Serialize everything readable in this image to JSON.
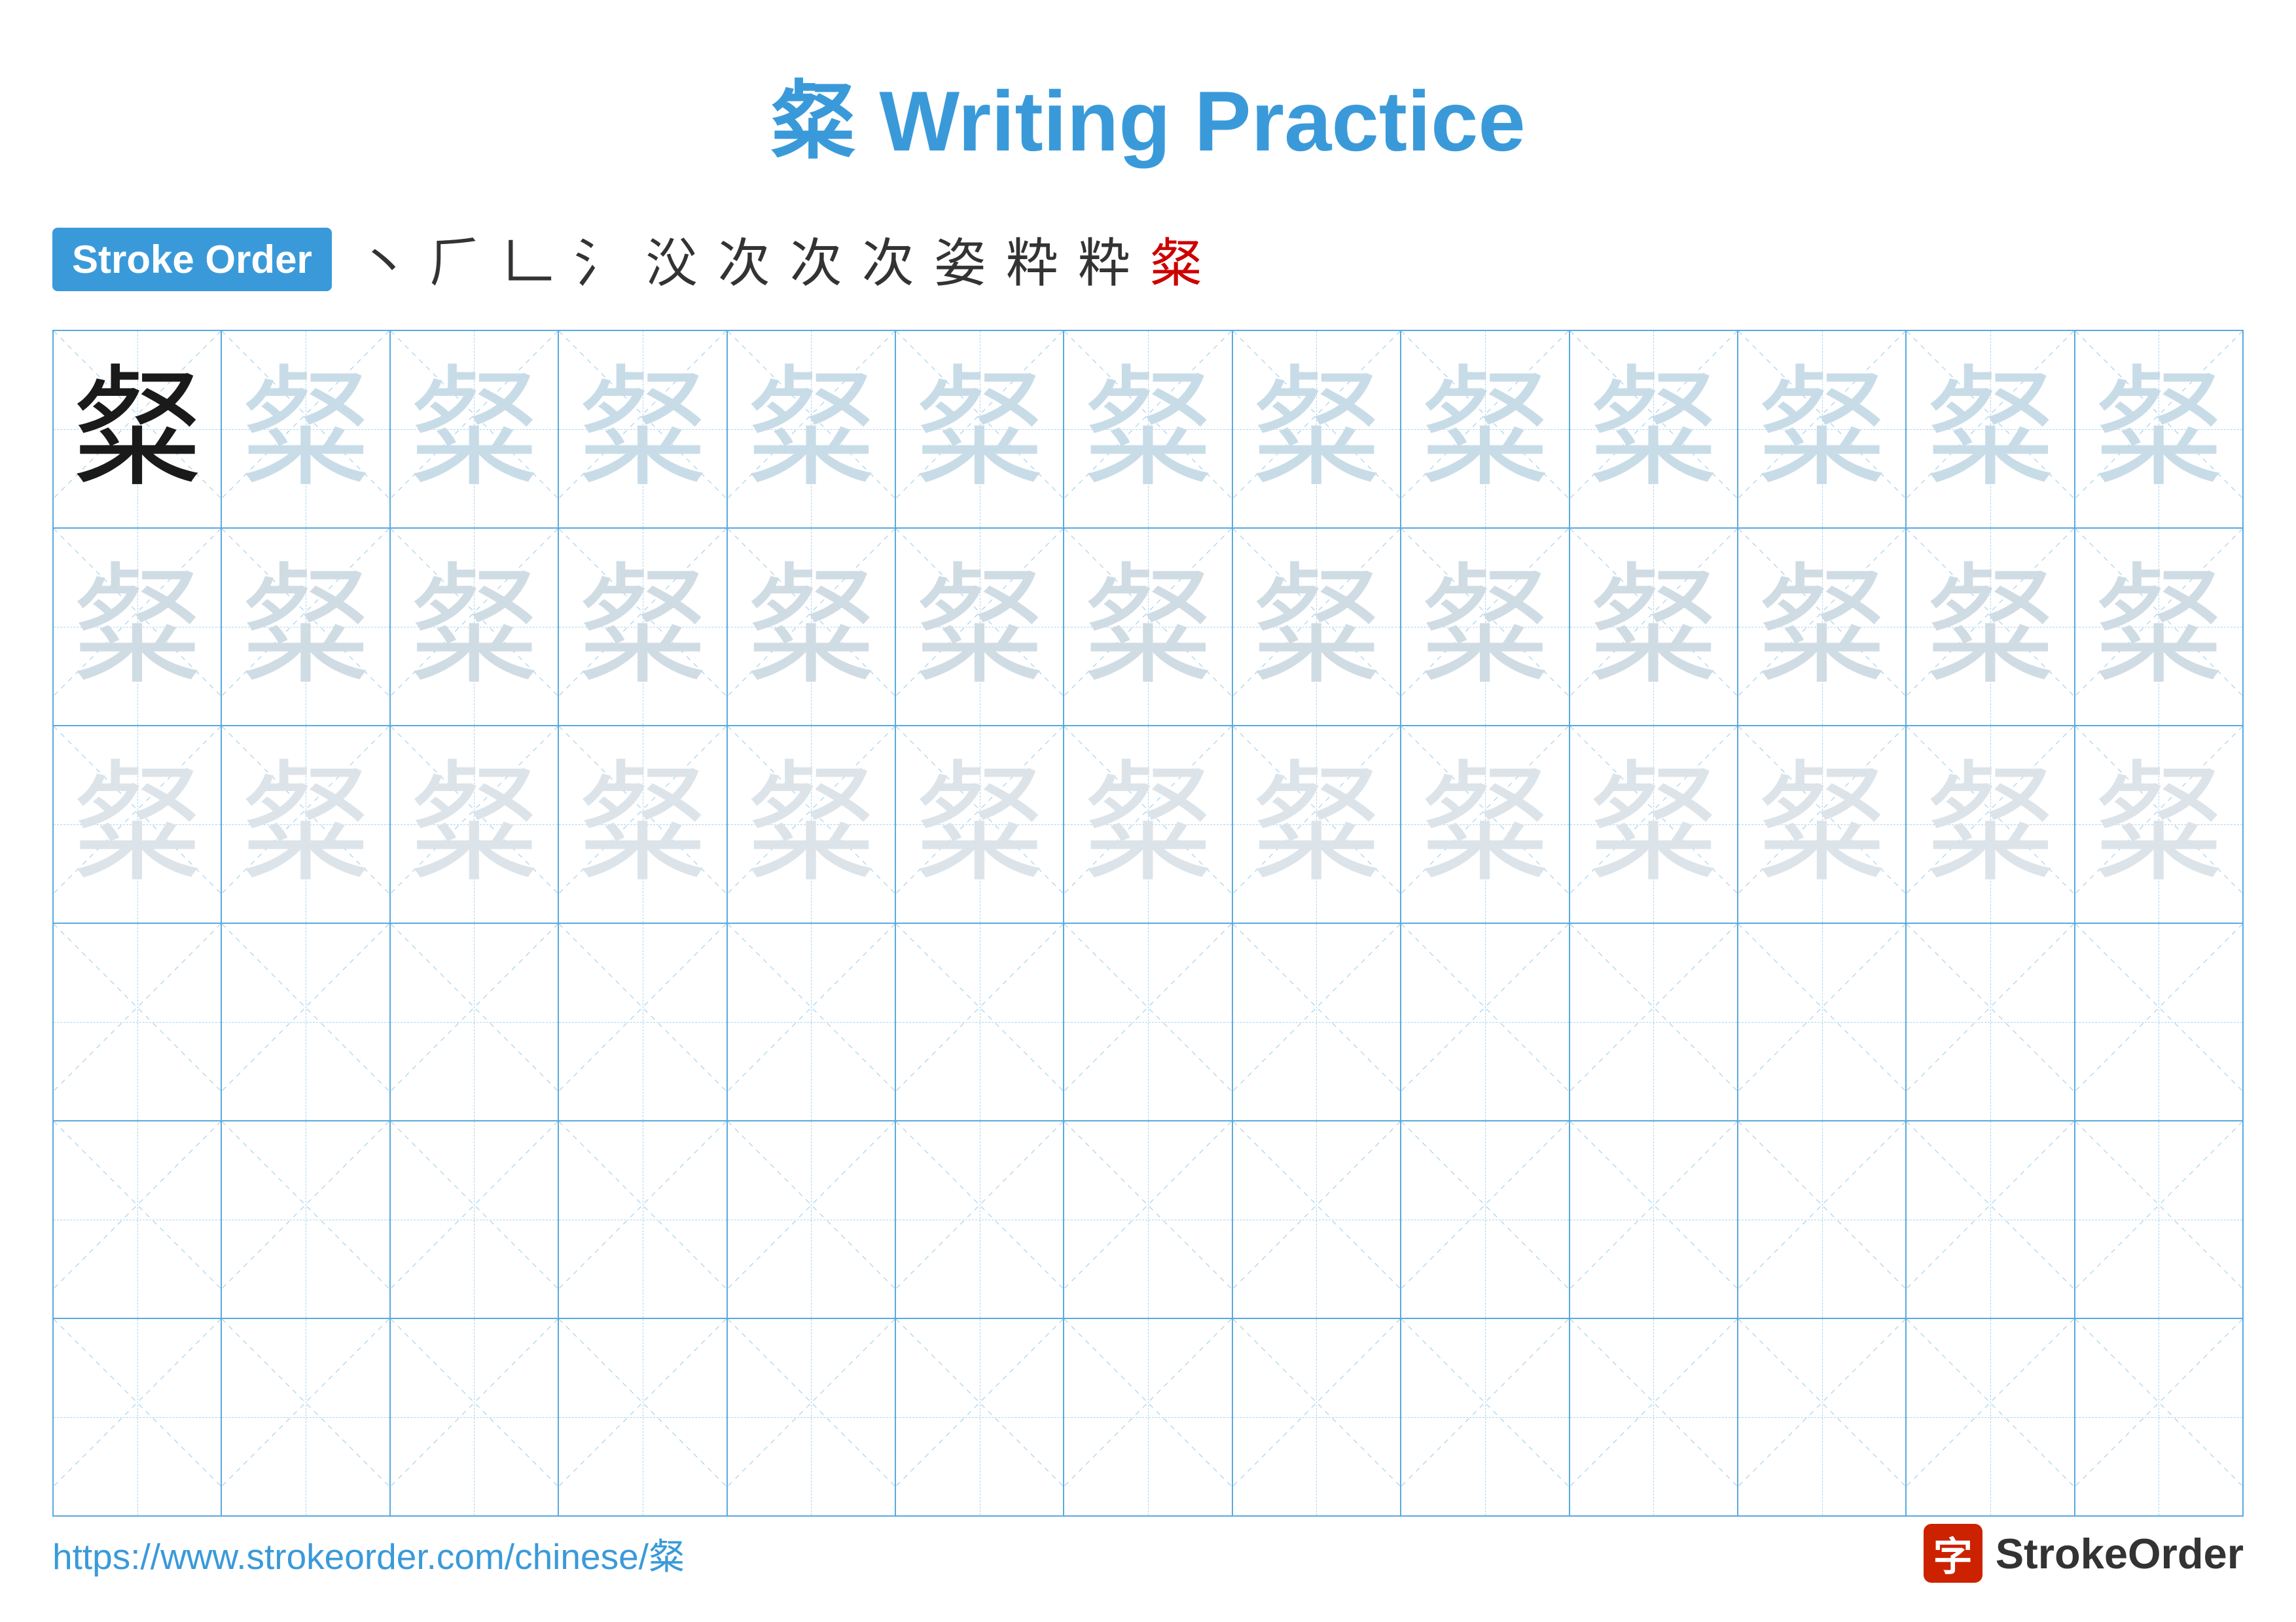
{
  "title": {
    "char": "粲",
    "label": "Writing Practice",
    "full": "粲 Writing Practice"
  },
  "stroke_order": {
    "badge_label": "Stroke Order",
    "strokes": [
      "丶",
      "㇀",
      "𝀇",
      "㇇",
      "㇇",
      "次",
      "次",
      "次",
      "姿",
      "粋",
      "粋",
      "粲"
    ]
  },
  "grid": {
    "cols": 13,
    "rows": 6,
    "char": "粲",
    "row_configs": [
      {
        "type": "dark_then_light1",
        "dark_count": 1
      },
      {
        "type": "light2"
      },
      {
        "type": "light3"
      },
      {
        "type": "empty"
      },
      {
        "type": "empty"
      },
      {
        "type": "empty"
      }
    ]
  },
  "footer": {
    "url": "https://www.strokeorder.com/chinese/粲",
    "logo_char": "字",
    "logo_text": "StrokeOrder"
  }
}
